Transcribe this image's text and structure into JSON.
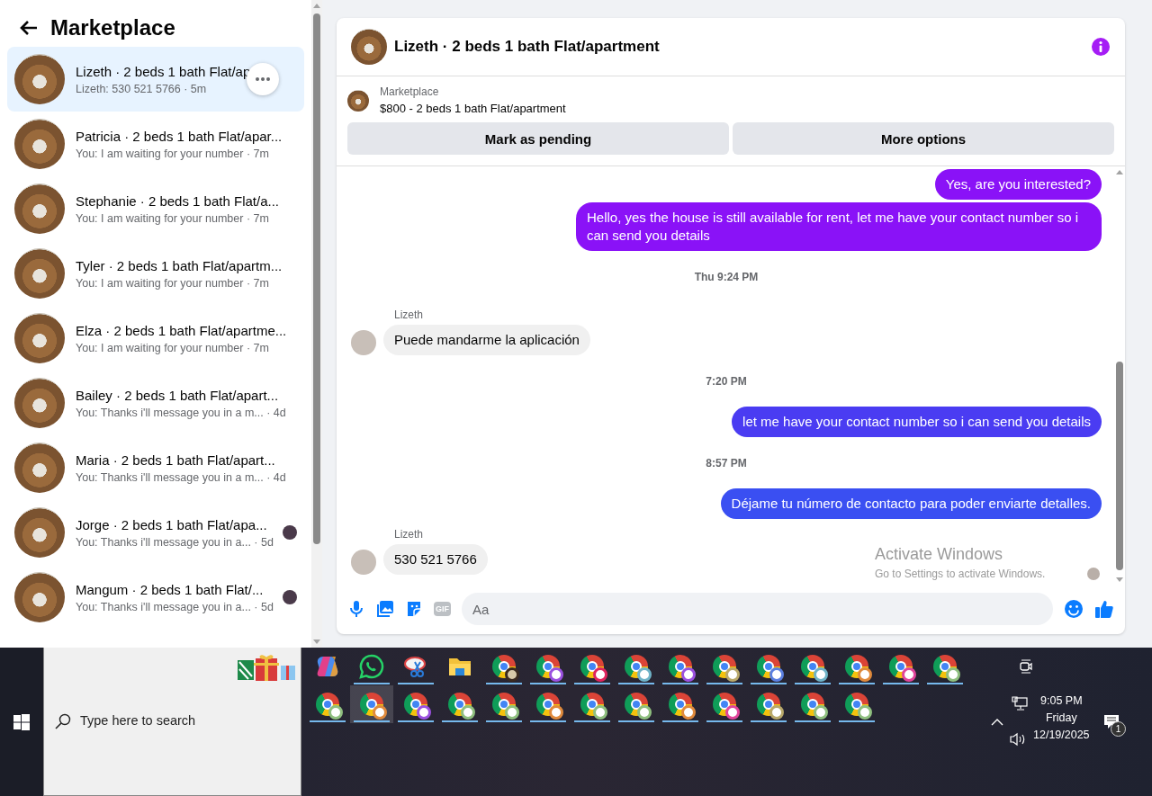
{
  "sidebar": {
    "title": "Marketplace"
  },
  "conversations": [
    {
      "title": "Lizeth · 2 beds 1 bath Flat/ap",
      "snippet": "Lizeth: 530 521 5766 · 5m",
      "selected": true,
      "seen_avatar": false
    },
    {
      "title": "Patricia · 2 beds 1 bath Flat/apar...",
      "snippet": "You: I am waiting for your number · 7m",
      "selected": false,
      "seen_avatar": false
    },
    {
      "title": "Stephanie · 2 beds 1 bath Flat/a...",
      "snippet": "You: I am waiting for your number · 7m",
      "selected": false,
      "seen_avatar": false
    },
    {
      "title": "Tyler · 2 beds 1 bath Flat/apartm...",
      "snippet": "You: I am waiting for your number · 7m",
      "selected": false,
      "seen_avatar": false
    },
    {
      "title": "Elza · 2 beds 1 bath Flat/apartme...",
      "snippet": "You: I am waiting for your number · 7m",
      "selected": false,
      "seen_avatar": false
    },
    {
      "title": "Bailey · 2 beds 1 bath Flat/apart...",
      "snippet": "You: Thanks i'll message you in a m... · 4d",
      "selected": false,
      "seen_avatar": false
    },
    {
      "title": "Maria · 2 beds 1 bath Flat/apart...",
      "snippet": "You: Thanks i'll message you in a m... · 4d",
      "selected": false,
      "seen_avatar": false
    },
    {
      "title": "Jorge · 2 beds 1 bath Flat/apa...",
      "snippet": "You: Thanks i'll message you in a... · 5d",
      "selected": false,
      "seen_avatar": true
    },
    {
      "title": "Mangum · 2 beds 1 bath Flat/...",
      "snippet": "You: Thanks i'll message you in a... · 5d",
      "selected": false,
      "seen_avatar": true
    }
  ],
  "chat": {
    "title": "Lizeth · 2 beds 1 bath Flat/apartment",
    "listing_source": "Marketplace",
    "listing_title": "$800 - 2 beds 1 bath Flat/apartment",
    "actions": [
      "Mark as pending",
      "More options"
    ]
  },
  "messages": [
    {
      "kind": "outgoing",
      "text": "Yes, are you interested?",
      "color": "#8a12f7"
    },
    {
      "kind": "outgoing",
      "text": "Hello, yes the house is still available for rent, let me have your contact number so i can send you details",
      "color": "#8a12f7"
    },
    {
      "kind": "timestamp",
      "text": "Thu 9:24 PM"
    },
    {
      "kind": "incoming",
      "sender": "Lizeth",
      "text": "Puede mandarme la aplicación"
    },
    {
      "kind": "timestamp",
      "text": "7:20 PM"
    },
    {
      "kind": "outgoing",
      "text": "let me have your contact number so i can send you details",
      "color": "#4a3cf2"
    },
    {
      "kind": "timestamp",
      "text": "8:57 PM"
    },
    {
      "kind": "outgoing",
      "text": "Déjame tu número de contacto para poder enviarte detalles.",
      "color": "#3a4ff2"
    },
    {
      "kind": "incoming",
      "sender": "Lizeth",
      "text": "530 521 5766"
    }
  ],
  "composer": {
    "gif_label": "GIF",
    "placeholder": "Aa"
  },
  "os_notice": {
    "title": "Activate Windows",
    "subtitle": "Go to Settings to activate Windows."
  },
  "taskbar": {
    "search_placeholder": "Type here to search",
    "app_rows": [
      [
        {
          "kind": "copilot",
          "running": false,
          "selected": false
        },
        {
          "kind": "whatsapp",
          "running": true,
          "selected": false
        },
        {
          "kind": "snipping",
          "running": true,
          "selected": false
        },
        {
          "kind": "folder",
          "running": false,
          "selected": false
        },
        {
          "kind": "chrome-photo",
          "running": true,
          "selected": false
        },
        {
          "kind": "chrome",
          "color": "#9b51e0",
          "running": true,
          "selected": false
        },
        {
          "kind": "chrome",
          "color": "#e0245e",
          "running": true,
          "selected": false
        },
        {
          "kind": "chrome",
          "color": "#6fb3c8",
          "running": true,
          "selected": false
        },
        {
          "kind": "chrome",
          "color": "#9b51e0",
          "running": true,
          "selected": false
        },
        {
          "kind": "chrome",
          "color": "#b8a86a",
          "running": true,
          "selected": false
        },
        {
          "kind": "chrome",
          "color": "#5b7fe0",
          "running": true,
          "selected": false
        },
        {
          "kind": "chrome",
          "color": "#6fb3c8",
          "running": true,
          "selected": false
        },
        {
          "kind": "chrome",
          "color": "#e08a3c",
          "running": true,
          "selected": false
        },
        {
          "kind": "chrome",
          "color": "#e0459b",
          "running": true,
          "selected": false
        },
        {
          "kind": "chrome",
          "color": "#8fbf7f",
          "running": true,
          "selected": false
        }
      ],
      [
        {
          "kind": "chrome",
          "color": "#8fbf7f",
          "running": true,
          "selected": false
        },
        {
          "kind": "chrome",
          "color": "#e08a3c",
          "running": true,
          "selected": true
        },
        {
          "kind": "chrome",
          "color": "#9b51e0",
          "running": true,
          "selected": false
        },
        {
          "kind": "chrome",
          "color": "#8fbf7f",
          "running": true,
          "selected": false
        },
        {
          "kind": "chrome",
          "color": "#8fbf7f",
          "running": true,
          "selected": false
        },
        {
          "kind": "chrome",
          "color": "#e08a3c",
          "running": true,
          "selected": false
        },
        {
          "kind": "chrome",
          "color": "#8fbf7f",
          "running": true,
          "selected": false
        },
        {
          "kind": "chrome",
          "color": "#8fbf7f",
          "running": true,
          "selected": false
        },
        {
          "kind": "chrome",
          "color": "#e08a3c",
          "running": true,
          "selected": false
        },
        {
          "kind": "chrome",
          "color": "#e0459b",
          "running": true,
          "selected": false
        },
        {
          "kind": "chrome",
          "color": "#b8a86a",
          "running": true,
          "selected": false
        },
        {
          "kind": "chrome",
          "color": "#8fbf7f",
          "running": true,
          "selected": false
        },
        {
          "kind": "chrome",
          "color": "#8fbf7f",
          "running": true,
          "selected": false
        }
      ]
    ],
    "clock": {
      "time": "9:05 PM",
      "day": "Friday",
      "date": "12/19/2025"
    },
    "notification_count": "1"
  }
}
